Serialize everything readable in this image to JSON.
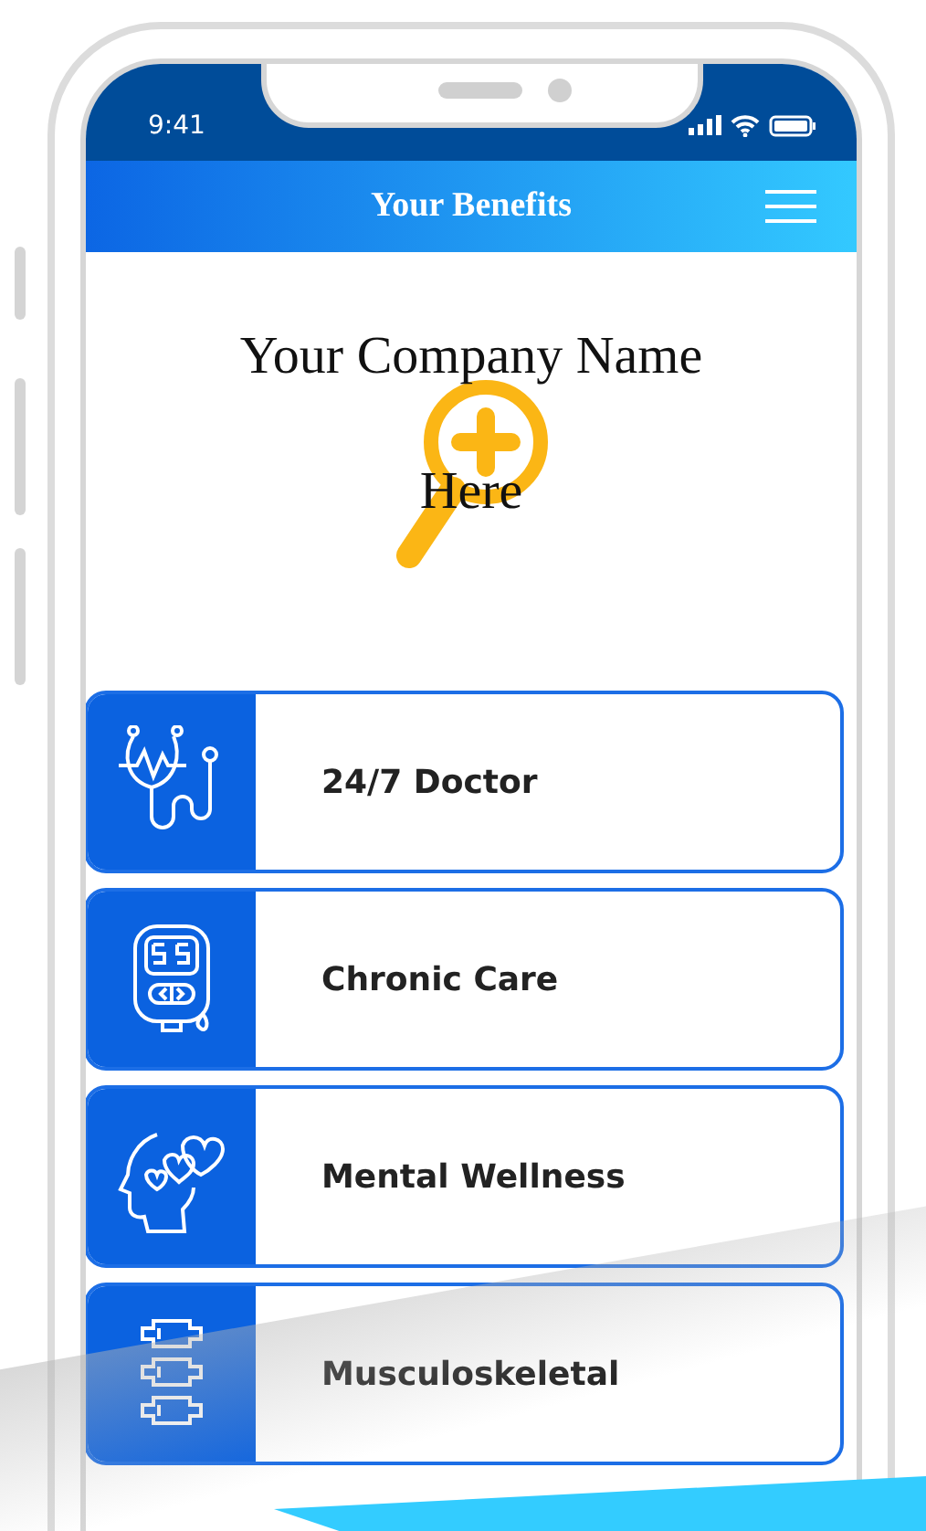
{
  "status_bar": {
    "time": "9:41"
  },
  "header": {
    "title": "Your Benefits"
  },
  "logo": {
    "lines": [
      "Your Company Name",
      "Here"
    ]
  },
  "benefits": [
    {
      "label": "24/7 Doctor"
    },
    {
      "label": "Chronic Care"
    },
    {
      "label": "Mental Wellness"
    },
    {
      "label": "Musculoskeletal"
    }
  ]
}
